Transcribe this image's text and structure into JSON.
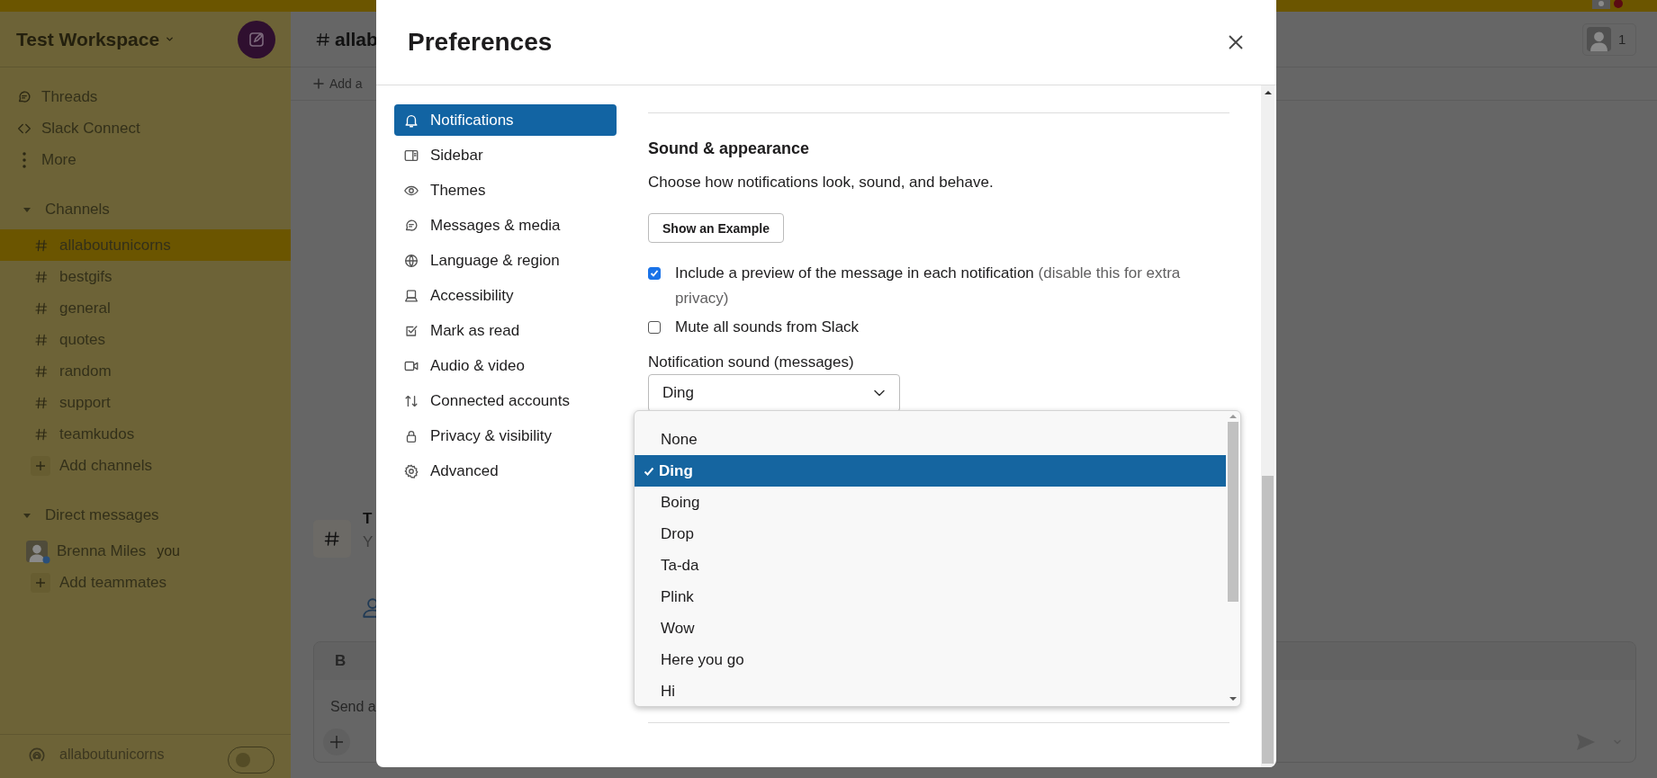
{
  "workspace": {
    "name": "Test Workspace"
  },
  "sidebar": {
    "nav": [
      {
        "label": "Threads"
      },
      {
        "label": "Slack Connect"
      },
      {
        "label": "More"
      }
    ],
    "channels_section": {
      "label": "Channels",
      "expanded": true
    },
    "channels": [
      {
        "name": "allaboutunicorns",
        "selected": true
      },
      {
        "name": "bestgifs",
        "selected": false
      },
      {
        "name": "general",
        "selected": false
      },
      {
        "name": "quotes",
        "selected": false
      },
      {
        "name": "random",
        "selected": false
      },
      {
        "name": "support",
        "selected": false
      },
      {
        "name": "teamkudos",
        "selected": false
      }
    ],
    "add_channels": "Add channels",
    "dm_section": {
      "label": "Direct messages",
      "expanded": true
    },
    "dms": [
      {
        "name": "Brenna Miles",
        "note": "you"
      }
    ],
    "add_teammates": "Add teammates",
    "huddle_channel": "allaboutunicorns",
    "huddle_on": false
  },
  "channel_header": {
    "title": "allab",
    "add_text": "Add a",
    "member_count": "1"
  },
  "intro": {
    "title": "T",
    "subtitle": "Y"
  },
  "composer": {
    "bold_label": "B",
    "placeholder": "Send a"
  },
  "preferences": {
    "title": "Preferences",
    "nav": [
      {
        "label": "Notifications",
        "selected": true
      },
      {
        "label": "Sidebar",
        "selected": false
      },
      {
        "label": "Themes",
        "selected": false
      },
      {
        "label": "Messages & media",
        "selected": false
      },
      {
        "label": "Language & region",
        "selected": false
      },
      {
        "label": "Accessibility",
        "selected": false
      },
      {
        "label": "Mark as read",
        "selected": false
      },
      {
        "label": "Audio & video",
        "selected": false
      },
      {
        "label": "Connected accounts",
        "selected": false
      },
      {
        "label": "Privacy & visibility",
        "selected": false
      },
      {
        "label": "Advanced",
        "selected": false
      }
    ],
    "section_title": "Sound & appearance",
    "description": "Choose how notifications look, sound, and behave.",
    "example_button": "Show an Example",
    "options": [
      {
        "label": "Include a preview of the message in each notification",
        "hint": "(disable this for extra privacy)",
        "checked": true
      },
      {
        "label": "Mute all sounds from Slack",
        "checked": false
      }
    ],
    "sound_label": "Notification sound (messages)",
    "sound_value": "Ding",
    "sound_options": [
      {
        "label": "None",
        "selected": false
      },
      {
        "label": "Ding",
        "selected": true
      },
      {
        "label": "Boing",
        "selected": false
      },
      {
        "label": "Drop",
        "selected": false
      },
      {
        "label": "Ta-da",
        "selected": false
      },
      {
        "label": "Plink",
        "selected": false
      },
      {
        "label": "Wow",
        "selected": false
      },
      {
        "label": "Here you go",
        "selected": false
      },
      {
        "label": "Hi",
        "selected": false
      }
    ]
  }
}
